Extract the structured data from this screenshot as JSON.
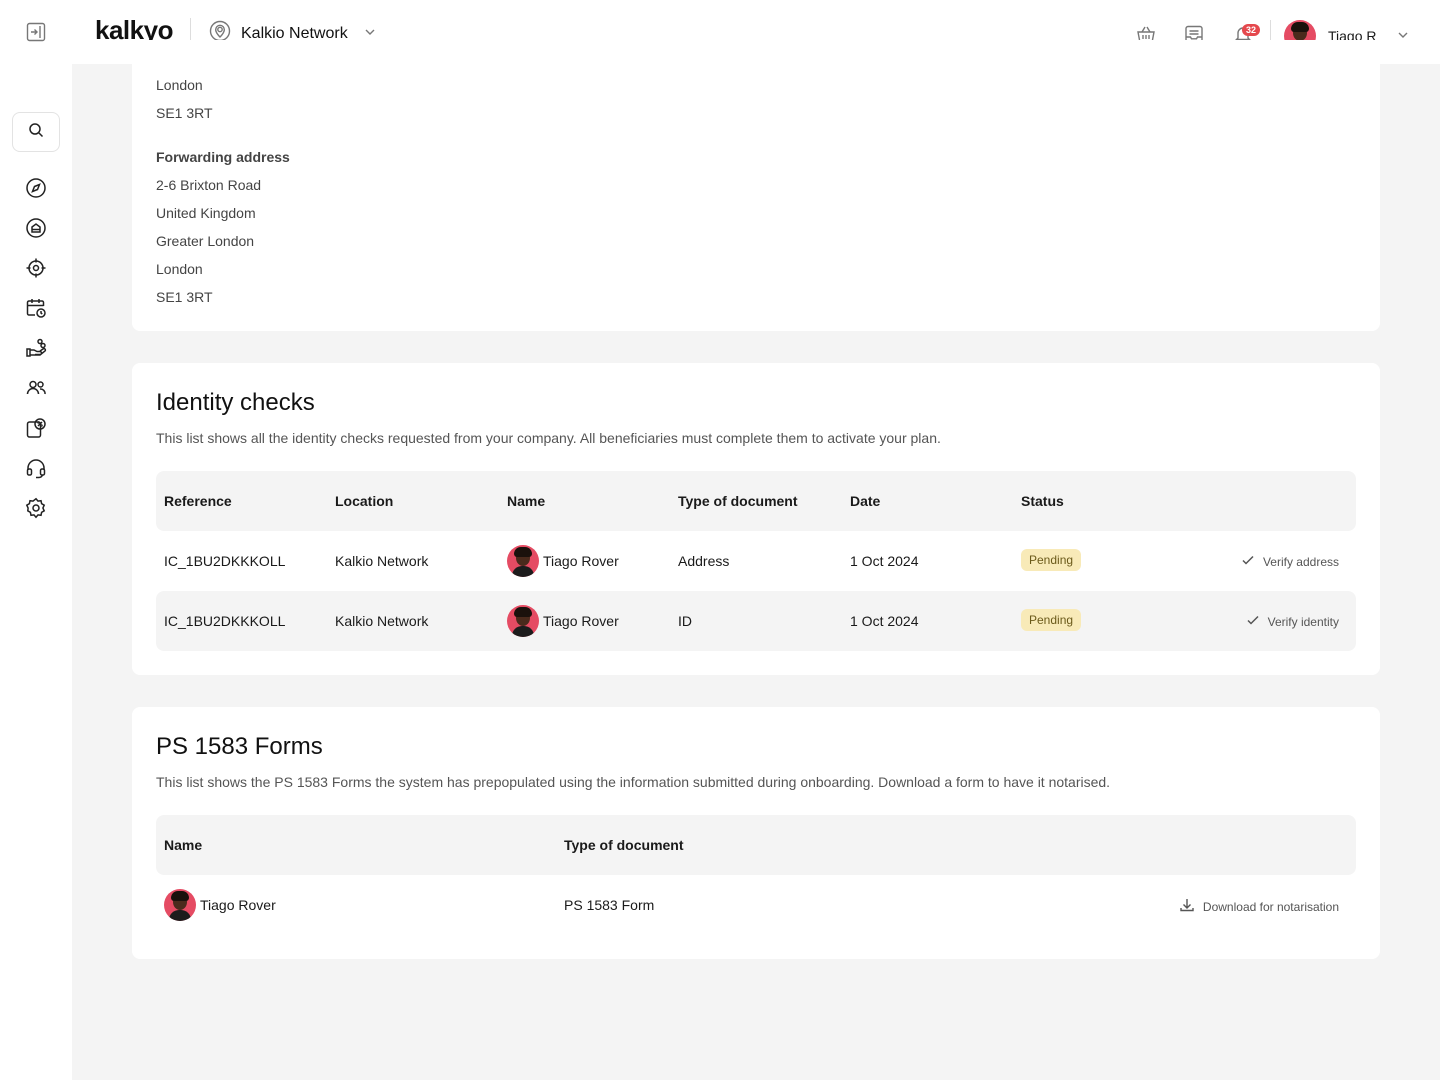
{
  "app": {
    "logo": "kalkyo",
    "workspace": "Kalkio Network",
    "notifications_count": "32",
    "user_name": "Tiago R"
  },
  "address_card": {
    "lines_top": [
      "London",
      "SE1 3RT"
    ],
    "forwarding_label": "Forwarding address",
    "forwarding_lines": [
      "2-6 Brixton Road",
      "United Kingdom",
      "Greater London",
      "London",
      "SE1 3RT"
    ]
  },
  "identity_checks": {
    "title": "Identity checks",
    "description": "This list shows all the identity checks requested from your company. All beneficiaries must complete them to activate your plan.",
    "columns": [
      "Reference",
      "Location",
      "Name",
      "Type of document",
      "Date",
      "Status"
    ],
    "rows": [
      {
        "reference": "IC_1BU2DKKKOLL",
        "location": "Kalkio Network",
        "name": "Tiago Rover",
        "type": "Address",
        "date": "1 Oct 2024",
        "status": "Pending",
        "action": "Verify address"
      },
      {
        "reference": "IC_1BU2DKKKOLL",
        "location": "Kalkio Network",
        "name": "Tiago Rover",
        "type": "ID",
        "date": "1 Oct 2024",
        "status": "Pending",
        "action": "Verify identity"
      }
    ]
  },
  "ps_forms": {
    "title": "PS 1583 Forms",
    "description": "This list shows the PS 1583 Forms the system has prepopulated using the information submitted during onboarding. Download a form to have it notarised.",
    "columns": [
      "Name",
      "Type of document"
    ],
    "rows": [
      {
        "name": "Tiago Rover",
        "type": "PS 1583 Form",
        "action": "Download for notarisation"
      }
    ]
  },
  "colors": {
    "background": "#f4f4f4",
    "pending_badge": "#f8eab8",
    "notification_badge": "#e5484d",
    "avatar_bg": "#e54b63"
  }
}
